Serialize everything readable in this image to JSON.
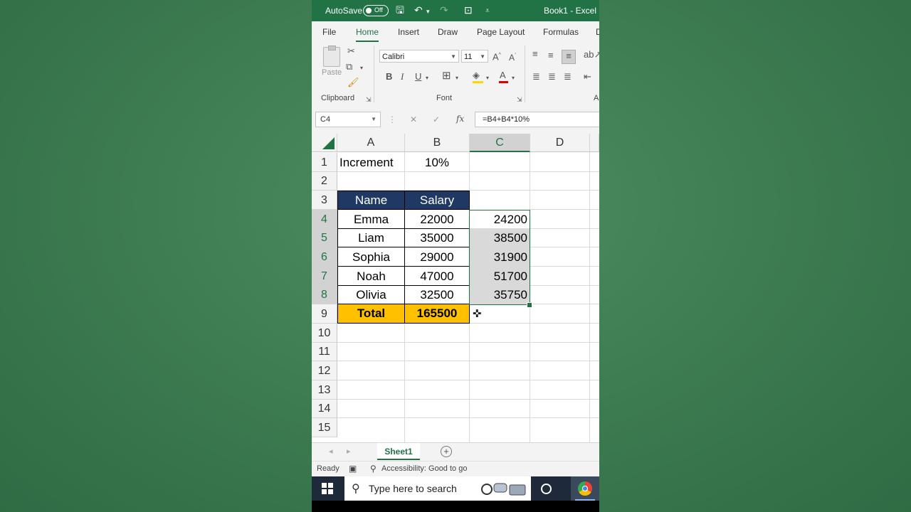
{
  "titlebar": {
    "autosave_label": "AutoSave",
    "autosave_state": "Off",
    "document_title": "Book1 - Excel"
  },
  "ribbon_tabs": [
    "File",
    "Home",
    "Insert",
    "Draw",
    "Page Layout",
    "Formulas",
    "D"
  ],
  "active_tab": "Home",
  "ribbon": {
    "paste_label": "Paste",
    "clipboard_group": "Clipboard",
    "font_group": "Font",
    "alignment_group": "A",
    "font_name": "Calibri",
    "font_size": "11",
    "bold": "B",
    "italic": "I",
    "underline": "U"
  },
  "formula_bar": {
    "name_box": "C4",
    "cancel": "✕",
    "enter": "✓",
    "fx": "fx",
    "formula": "=B4+B4*10%"
  },
  "grid": {
    "columns": [
      "A",
      "B",
      "C",
      "D"
    ],
    "selected_column": "C",
    "rows": [
      "1",
      "2",
      "3",
      "4",
      "5",
      "6",
      "7",
      "8",
      "9",
      "10",
      "11",
      "12",
      "13",
      "14",
      "15"
    ],
    "cells": {
      "A1": "Increment",
      "B1": "10%",
      "A3": "Name",
      "B3": "Salary",
      "A4": "Emma",
      "B4": "22000",
      "C4": "24200",
      "A5": "Liam",
      "B5": "35000",
      "C5": "38500",
      "A6": "Sophia",
      "B6": "29000",
      "C6": "31900",
      "A7": "Noah",
      "B7": "47000",
      "C7": "51700",
      "A8": "Olivia",
      "B8": "32500",
      "C8": "35750",
      "A9": "Total",
      "B9": "165500"
    }
  },
  "sheets": [
    "Sheet1"
  ],
  "status": {
    "ready": "Ready",
    "accessibility": "Accessibility: Good to go"
  },
  "taskbar": {
    "search_placeholder": "Type here to search"
  },
  "colors": {
    "excel_green": "#217346",
    "header_fill": "#203864",
    "total_fill": "#ffc000",
    "background": "#3f7d52"
  }
}
